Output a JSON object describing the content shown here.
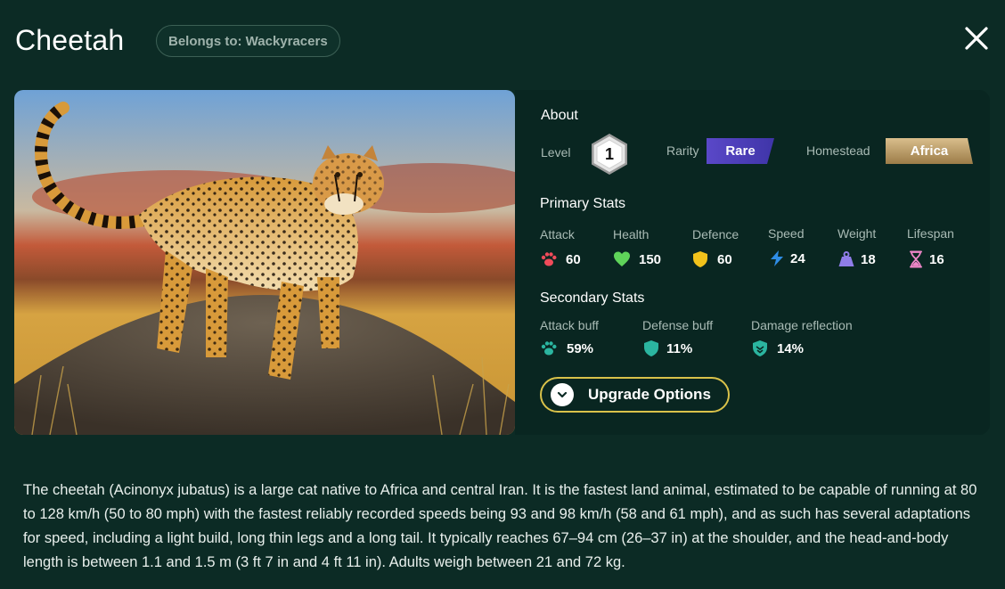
{
  "header": {
    "title": "Cheetah",
    "owner_badge": "Belongs to: Wackyracers",
    "close_icon": "close-icon"
  },
  "image": {
    "subject": "cheetah-illustration"
  },
  "about": {
    "heading": "About",
    "level_label": "Level",
    "level_value": "1",
    "rarity_label": "Rarity",
    "rarity_value": "Rare",
    "homestead_label": "Homestead",
    "homestead_value": "Africa"
  },
  "primary": {
    "heading": "Primary Stats",
    "stats": [
      {
        "label": "Attack",
        "value": "60",
        "icon": "paw-icon",
        "color": "#f04b5a"
      },
      {
        "label": "Health",
        "value": "150",
        "icon": "heart-icon",
        "color": "#5fd35a"
      },
      {
        "label": "Defence",
        "value": "60",
        "icon": "shield-icon",
        "color": "#f2c21b"
      },
      {
        "label": "Speed",
        "value": "24",
        "icon": "lightning-icon",
        "color": "#2f8de6"
      },
      {
        "label": "Weight",
        "value": "18",
        "icon": "weight-icon",
        "color": "#8f7de8"
      },
      {
        "label": "Lifespan",
        "value": "16",
        "icon": "hourglass-icon",
        "color": "#ee86c8"
      }
    ]
  },
  "secondary": {
    "heading": "Secondary Stats",
    "stats": [
      {
        "label": "Attack buff",
        "value": "59%",
        "icon": "paw-icon",
        "color": "#2bb5a0"
      },
      {
        "label": "Defense buff",
        "value": "11%",
        "icon": "shield-icon",
        "color": "#2bb5a0"
      },
      {
        "label": "Damage reflection",
        "value": "14%",
        "icon": "reflect-shield-icon",
        "color": "#2bb5a0"
      }
    ]
  },
  "upgrade": {
    "label": "Upgrade Options",
    "icon": "chevron-down-icon"
  },
  "colors": {
    "background": "#0c2b25",
    "panel": "#092621",
    "rare": "#4a3fb8",
    "africa": "#c8a977",
    "accent": "#d9c24a"
  },
  "description": "The cheetah (Acinonyx jubatus) is a large cat native to Africa and central Iran. It is the fastest land animal, estimated to be capable of running at 80 to 128 km/h (50 to 80 mph) with the fastest reliably recorded speeds being 93 and 98 km/h (58 and 61 mph), and as such has several adaptations for speed, including a light build, long thin legs and a long tail. It typically reaches 67–94 cm (26–37 in) at the shoulder, and the head-and-body length is between 1.1 and 1.5 m (3 ft 7 in and 4 ft 11 in). Adults weigh between 21 and 72 kg."
}
